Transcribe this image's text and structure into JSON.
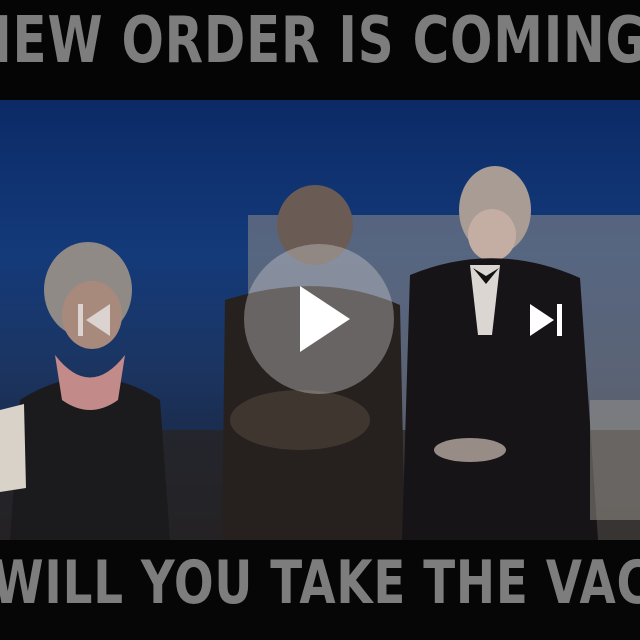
{
  "video": {
    "caption_top": "NEW ORDER IS COMING",
    "caption_bottom": "WILL YOU TAKE THE VACCINE?",
    "controls": {
      "previous_icon": "skip-previous-icon",
      "play_icon": "play-icon",
      "next_icon": "skip-next-icon"
    },
    "colors": {
      "caption_text": "#7d7d7d",
      "background_blue": "#143a7a",
      "band_black": "#050505"
    }
  }
}
